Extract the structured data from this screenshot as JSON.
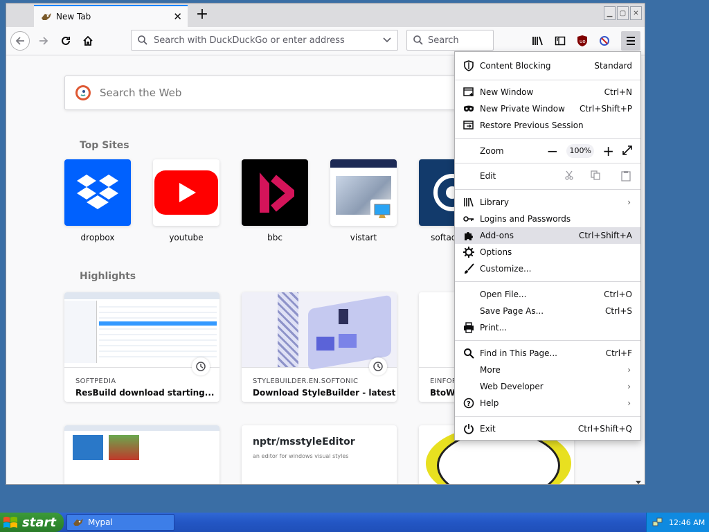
{
  "tab": {
    "title": "New Tab"
  },
  "navbar": {
    "url_placeholder": "Search with DuckDuckGo or enter address",
    "search_placeholder": "Search"
  },
  "content": {
    "web_search_placeholder": "Search the Web",
    "top_sites_title": "Top Sites",
    "highlights_title": "Highlights",
    "top_sites": [
      {
        "label": "dropbox"
      },
      {
        "label": "youtube"
      },
      {
        "label": "bbc"
      },
      {
        "label": "vistart"
      },
      {
        "label": "softadvice"
      }
    ],
    "highlights": [
      {
        "source": "SOFTPEDIA",
        "title": "ResBuild download starting..."
      },
      {
        "source": "STYLEBUILDER.EN.SOFTONIC",
        "title": "Download StyleBuilder - latest v..."
      },
      {
        "source": "EINFOR",
        "title": "BtoWe"
      }
    ],
    "highlight_row2": {
      "second_title": "nptr/msstyleEditor",
      "second_sub": "an editor for windows visual styles"
    }
  },
  "menu": {
    "content_blocking": {
      "label": "Content Blocking",
      "value": "Standard"
    },
    "new_window": {
      "label": "New Window",
      "shortcut": "Ctrl+N"
    },
    "new_private_window": {
      "label": "New Private Window",
      "shortcut": "Ctrl+Shift+P"
    },
    "restore_session": {
      "label": "Restore Previous Session"
    },
    "zoom": {
      "label": "Zoom",
      "value": "100%"
    },
    "edit": {
      "label": "Edit"
    },
    "library": {
      "label": "Library"
    },
    "logins": {
      "label": "Logins and Passwords"
    },
    "addons": {
      "label": "Add-ons",
      "shortcut": "Ctrl+Shift+A"
    },
    "options": {
      "label": "Options"
    },
    "customize": {
      "label": "Customize..."
    },
    "open_file": {
      "label": "Open File...",
      "shortcut": "Ctrl+O"
    },
    "save_page": {
      "label": "Save Page As...",
      "shortcut": "Ctrl+S"
    },
    "print": {
      "label": "Print..."
    },
    "find": {
      "label": "Find in This Page...",
      "shortcut": "Ctrl+F"
    },
    "more": {
      "label": "More"
    },
    "web_developer": {
      "label": "Web Developer"
    },
    "help": {
      "label": "Help"
    },
    "exit": {
      "label": "Exit",
      "shortcut": "Ctrl+Shift+Q"
    }
  },
  "taskbar": {
    "start_label": "start",
    "task_label": "Mypal",
    "clock": "12:46 AM"
  },
  "colors": {
    "accent": "#0a84ff",
    "taskbar": "#2356c4",
    "start": "#2f8a2e",
    "desktop": "#3a6ea5"
  }
}
